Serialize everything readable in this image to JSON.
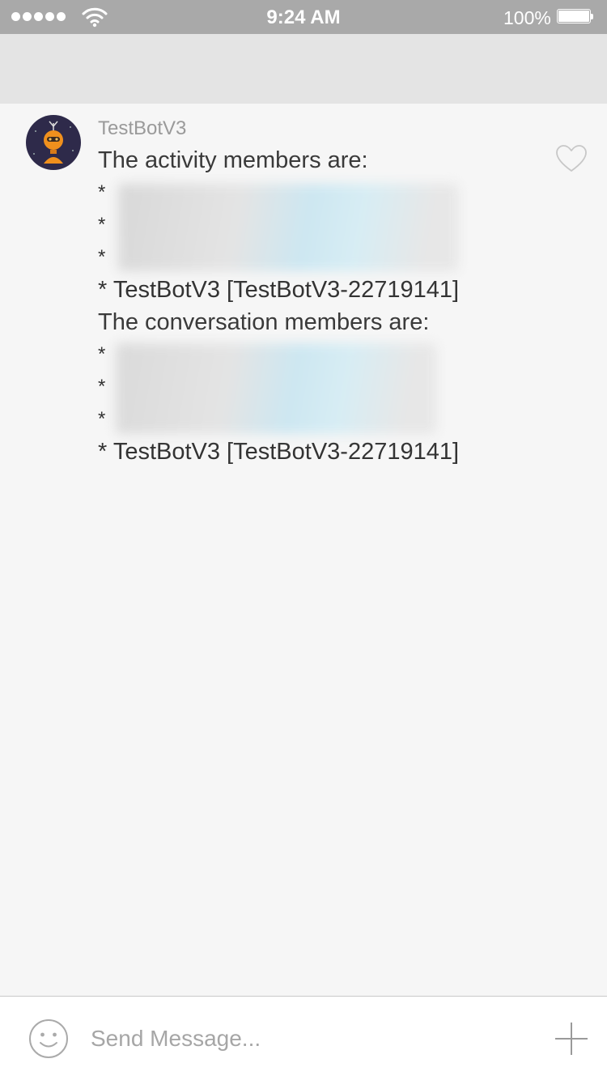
{
  "status_bar": {
    "time": "9:24 AM",
    "battery_percent": "100%",
    "signal_bars": 5,
    "icons": [
      "signal-dots-icon",
      "wifi-icon",
      "battery-icon"
    ]
  },
  "message": {
    "sender": "TestBotV3",
    "avatar_icon": "bot-avatar-icon",
    "lines": [
      "The activity members are:",
      "*",
      "*",
      "*",
      "* TestBotV3 [TestBotV3-22719141]",
      "The conversation members are:",
      "*",
      "*",
      "*",
      "* TestBotV3 [TestBotV3-22719141]"
    ],
    "like_icon": "heart-outline-icon"
  },
  "composer": {
    "placeholder": "Send Message...",
    "value": "",
    "emoji_icon": "smiley-icon",
    "add_icon": "plus-icon"
  },
  "colors": {
    "status_bar_bg": "#a9a9a9",
    "nav_bar_bg": "#e4e4e4",
    "chat_bg": "#f6f6f6",
    "composer_bg": "#ffffff",
    "avatar_bg": "#2e2a4a",
    "avatar_accent": "#f0901d"
  }
}
